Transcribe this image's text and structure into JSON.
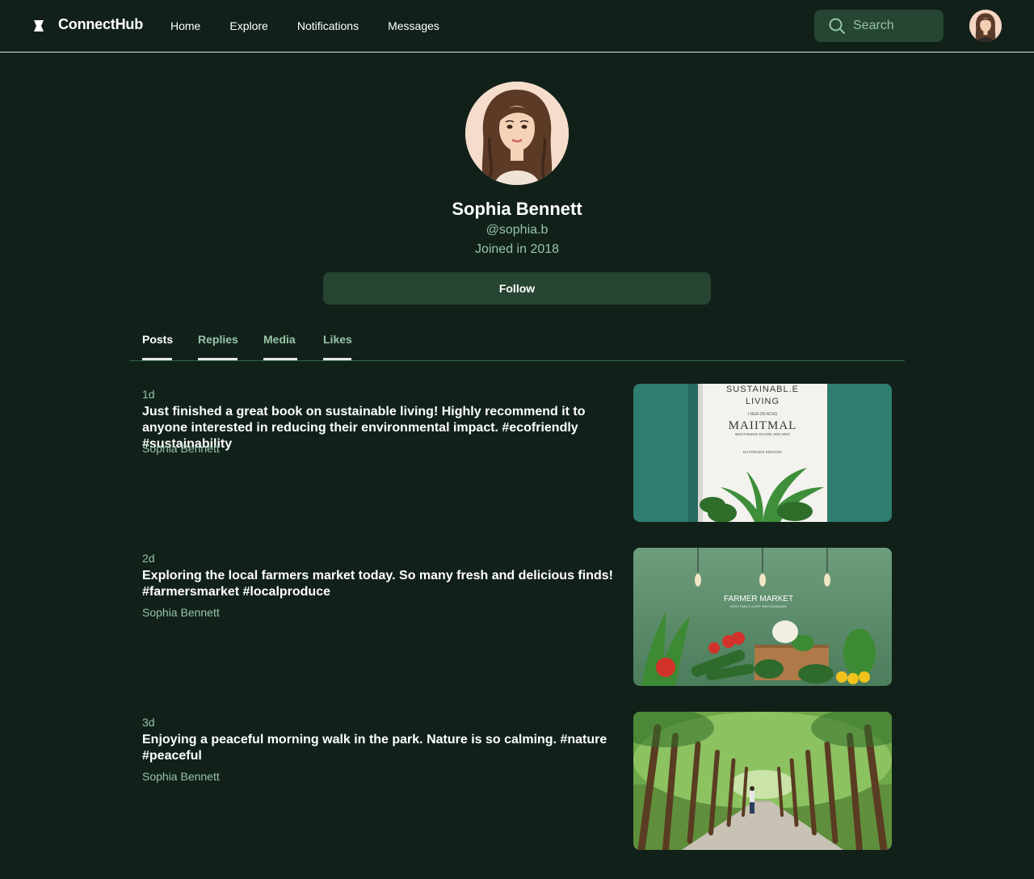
{
  "header": {
    "brand": "ConnectHub",
    "nav": [
      "Home",
      "Explore",
      "Notifications",
      "Messages"
    ],
    "search_placeholder": "Search"
  },
  "profile": {
    "name": "Sophia Bennett",
    "handle": "@sophia.b",
    "joined": "Joined in 2018",
    "follow_label": "Follow"
  },
  "tabs": [
    "Posts",
    "Replies",
    "Media",
    "Likes"
  ],
  "active_tab": "Posts",
  "posts": [
    {
      "time": "1d",
      "text": "Just finished a great book on sustainable living! Highly recommend it to anyone interested in reducing their environmental impact. #ecofriendly #sustainability",
      "author": "Sophia Bennett",
      "image_text": [
        "SUSTAINABL.E",
        "LIVING",
        "I NGA DN ACAS",
        "MAIITMAL",
        "BNOTHIWAIK ECORE SDN NNG",
        "DA FORLIDS EDIXOOK"
      ]
    },
    {
      "time": "2d",
      "text": "Exploring the local farmers market today. So many fresh and delicious finds! #farmersmarket #localproduce",
      "author": "Sophia Bennett",
      "image_text": [
        "FARMER MARKET",
        "ROST FARLS OURR RARTOONNODE"
      ]
    },
    {
      "time": "3d",
      "text": "Enjoying a peaceful morning walk in the park. Nature is so calming. #nature #peaceful",
      "author": "Sophia Bennett",
      "image_text": []
    }
  ],
  "colors": {
    "background": "#112119",
    "surface": "#264532",
    "muted_text": "#96c4a8",
    "divider": "#366348"
  }
}
